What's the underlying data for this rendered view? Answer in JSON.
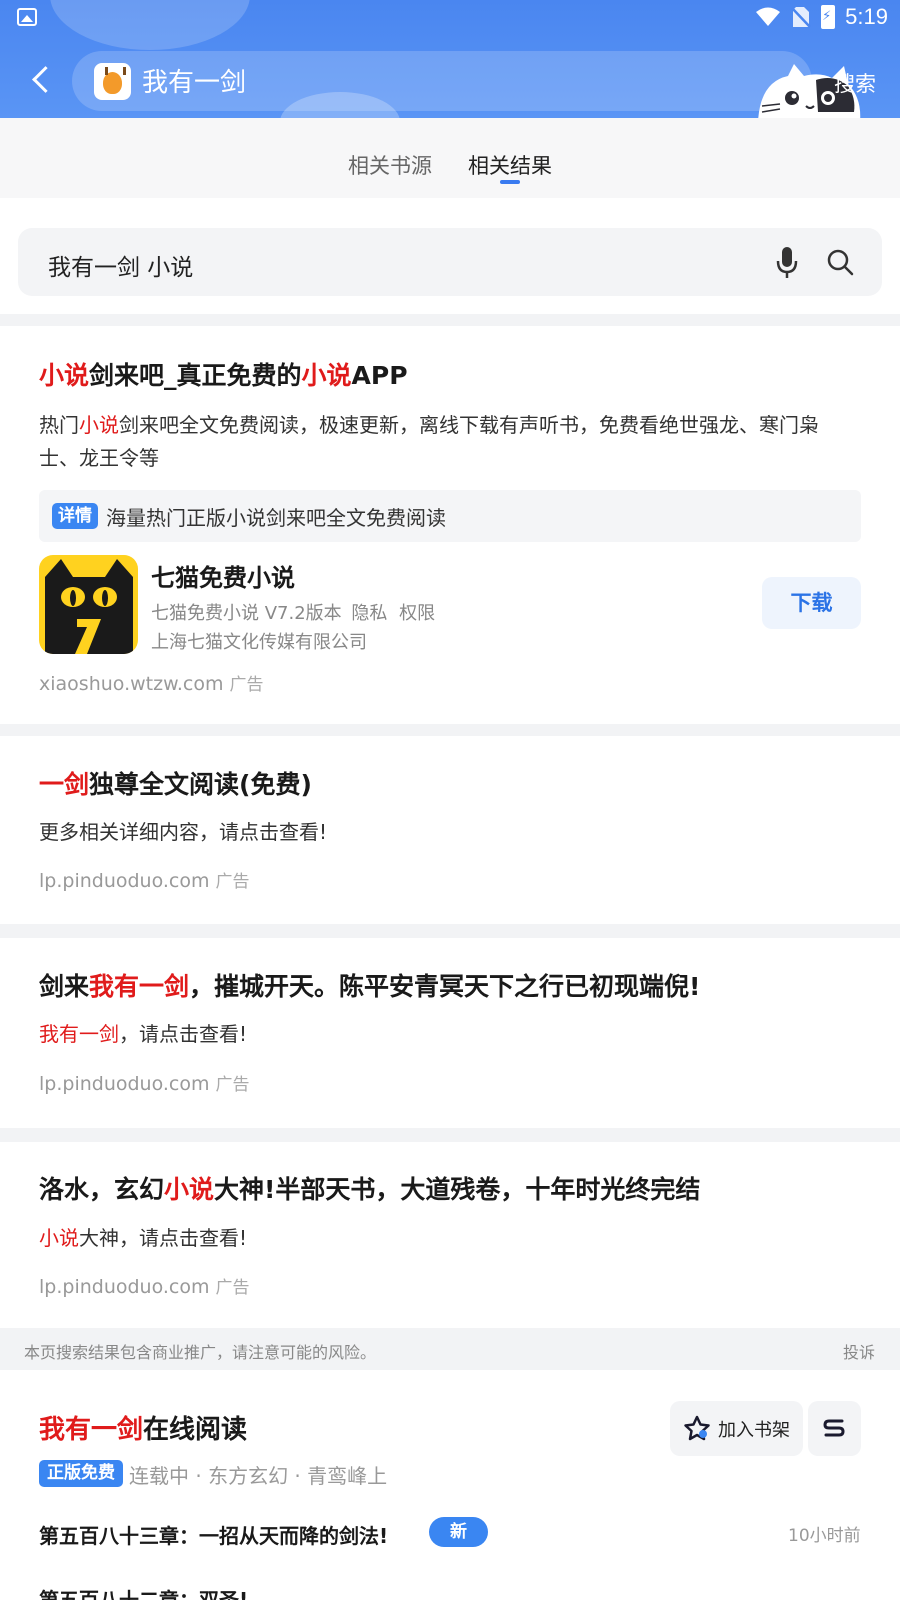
{
  "status_bar": {
    "time": "5:19"
  },
  "header": {
    "query": "我有一剑",
    "search_label": "搜索"
  },
  "tabs": [
    {
      "label": "相关书源"
    },
    {
      "label": "相关结果"
    }
  ],
  "search": {
    "text": "我有一剑 小说"
  },
  "results": [
    {
      "title": [
        {
          "text": "小说",
          "hl": true
        },
        {
          "text": "剑来吧_真正免费的",
          "hl": false
        },
        {
          "text": "小说",
          "hl": true
        },
        {
          "text": "APP",
          "hl": false
        }
      ],
      "desc_line1": [
        {
          "text": "热门",
          "hl": false
        },
        {
          "text": "小说",
          "hl": true
        },
        {
          "text": "剑来吧全文免费阅读，极速更新，离线下载有声听书，免费看绝世强龙、寒门枭",
          "hl": false
        }
      ],
      "desc_line2": "士、龙王令等",
      "detail_tag": "详情",
      "detail_text": "海量热门正版小说剑来吧全文免费阅读",
      "app": {
        "name": "七猫免费小说",
        "version": "七猫免费小说 V7.2版本",
        "privacy": "隐私",
        "permissions": "权限",
        "company": "上海七猫文化传媒有限公司",
        "download": "下载"
      },
      "source": "xiaoshuo.wtzw.com",
      "ad": "广告"
    },
    {
      "title": [
        {
          "text": "一剑",
          "hl": true
        },
        {
          "text": "独尊全文阅读(免费)",
          "hl": false
        }
      ],
      "desc": [
        {
          "text": "更多相关详细内容，请点击查看!",
          "hl": false
        }
      ],
      "source": "lp.pinduoduo.com",
      "ad": "广告"
    },
    {
      "title": [
        {
          "text": "剑来",
          "hl": false
        },
        {
          "text": "我有一剑",
          "hl": true
        },
        {
          "text": "，摧城开天。陈平安青冥天下之行已初现端倪!",
          "hl": false
        }
      ],
      "desc": [
        {
          "text": "我有一剑",
          "hl": true
        },
        {
          "text": "，请点击查看!",
          "hl": false
        }
      ],
      "source": "lp.pinduoduo.com",
      "ad": "广告"
    },
    {
      "title": [
        {
          "text": "洛水，玄幻",
          "hl": false
        },
        {
          "text": "小说",
          "hl": true
        },
        {
          "text": "大神!半部天书，大道残卷，十年时光终完结",
          "hl": false
        }
      ],
      "desc": [
        {
          "text": "小说",
          "hl": true
        },
        {
          "text": "大神，请点击查看!",
          "hl": false
        }
      ],
      "source": "lp.pinduoduo.com",
      "ad": "广告"
    }
  ],
  "footer_note": {
    "text": "本页搜索结果包含商业推广，请注意可能的风险。",
    "report": "投诉"
  },
  "book": {
    "title": [
      {
        "text": "我有一剑",
        "hl": true
      },
      {
        "text": "在线阅读",
        "hl": false
      }
    ],
    "add_shelf": "加入书架",
    "tag": "正版免费",
    "meta": "连载中 · 东方玄幻 · 青鸾峰上",
    "chapters": [
      {
        "title": "第五百八十三章：一招从天而降的剑法!",
        "badge": "新",
        "time": "10小时前"
      },
      {
        "title": "第五百八十二章：双圣!"
      }
    ]
  },
  "colors": {
    "header_blue": "#4a86f0",
    "highlight_red": "#e01b1b",
    "tag_blue": "#3a86f2",
    "download_blue": "#2b73e6"
  }
}
